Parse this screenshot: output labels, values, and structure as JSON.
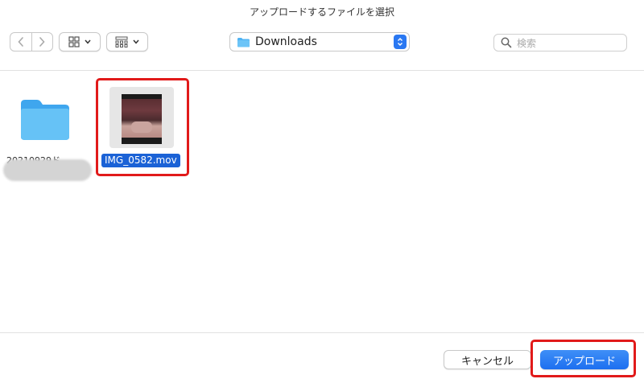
{
  "dialog": {
    "title": "アップロードするファイルを選択"
  },
  "toolbar": {
    "back_icon": "chevron-left-icon",
    "forward_icon": "chevron-right-icon",
    "view_icons_label": "icon-grid-icon",
    "view_group_label": "group-grid-icon",
    "location": "Downloads",
    "search_placeholder": "検索"
  },
  "files": [
    {
      "name": "20210929ド...",
      "kind": "folder",
      "selected": false,
      "label_obscured": true
    },
    {
      "name": "IMG_0582.mov",
      "kind": "video",
      "selected": true
    }
  ],
  "footer": {
    "cancel_label": "キャンセル",
    "upload_label": "アップロード"
  },
  "colors": {
    "accent": "#1d6ff0",
    "selection": "#1b62d6",
    "highlight": "#e11a1a",
    "folder": "#4fb3f3"
  }
}
